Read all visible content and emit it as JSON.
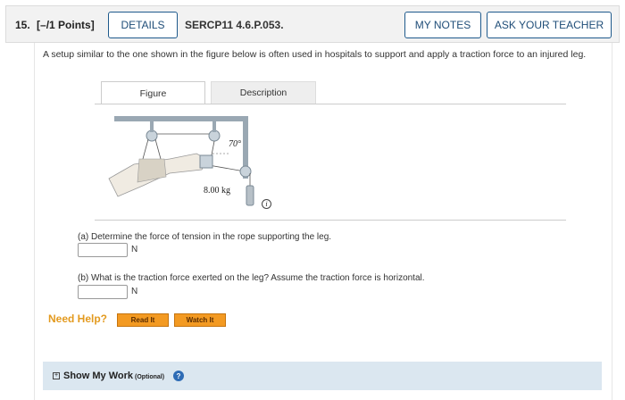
{
  "question": {
    "number_label": "15.",
    "points_label": "[–/1 Points]",
    "details_button": "DETAILS",
    "id": "SERCP11 4.6.P.053.",
    "my_notes_button": "MY NOTES",
    "ask_teacher_button": "ASK YOUR TEACHER"
  },
  "prompt": "A setup similar to the one shown in the figure below is often used in hospitals to support and apply a traction force to an injured leg.",
  "tabs": [
    "Figure",
    "Description"
  ],
  "figure": {
    "angle_label": "70°",
    "mass_label": "8.00 kg"
  },
  "info_icon": "i",
  "parts": [
    {
      "text": "(a) Determine the force of tension in the rope supporting the leg.",
      "unit": "N",
      "value": ""
    },
    {
      "text": "(b) What is the traction force exerted on the leg? Assume the traction force is horizontal.",
      "unit": "N",
      "value": ""
    }
  ],
  "help": {
    "label": "Need Help?",
    "read_button": "Read It",
    "watch_button": "Watch It"
  },
  "show_work": {
    "label": "Show My Work",
    "optional": "(Optional)"
  },
  "icons": {
    "info": "info-icon",
    "expand": "plus-box-icon",
    "help": "question-icon"
  }
}
